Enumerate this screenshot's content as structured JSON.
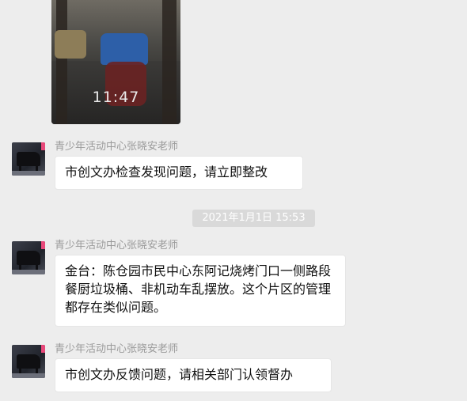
{
  "chat": {
    "photo": {
      "time_text": "11:47"
    },
    "messages": [
      {
        "sender": "青少年活动中心张晓安老师",
        "text": "市创文办检查发现问题，请立即整改"
      },
      {
        "sender": "青少年活动中心张晓安老师",
        "text": "金台：陈仓园市民中心东阿记烧烤门口一侧路段餐厨垃圾桶、非机动车乱摆放。这个片区的管理都存在类似问题。"
      },
      {
        "sender": "青少年活动中心张晓安老师",
        "text": "市创文办反馈问题，请相关部门认领督办"
      }
    ],
    "timestamp": "2021年1月1日 15:53"
  },
  "colors": {
    "background": "#ededed",
    "bubble": "#ffffff",
    "sender_text": "#9a9a9a",
    "timestamp_bg": "#d9d9d9"
  }
}
